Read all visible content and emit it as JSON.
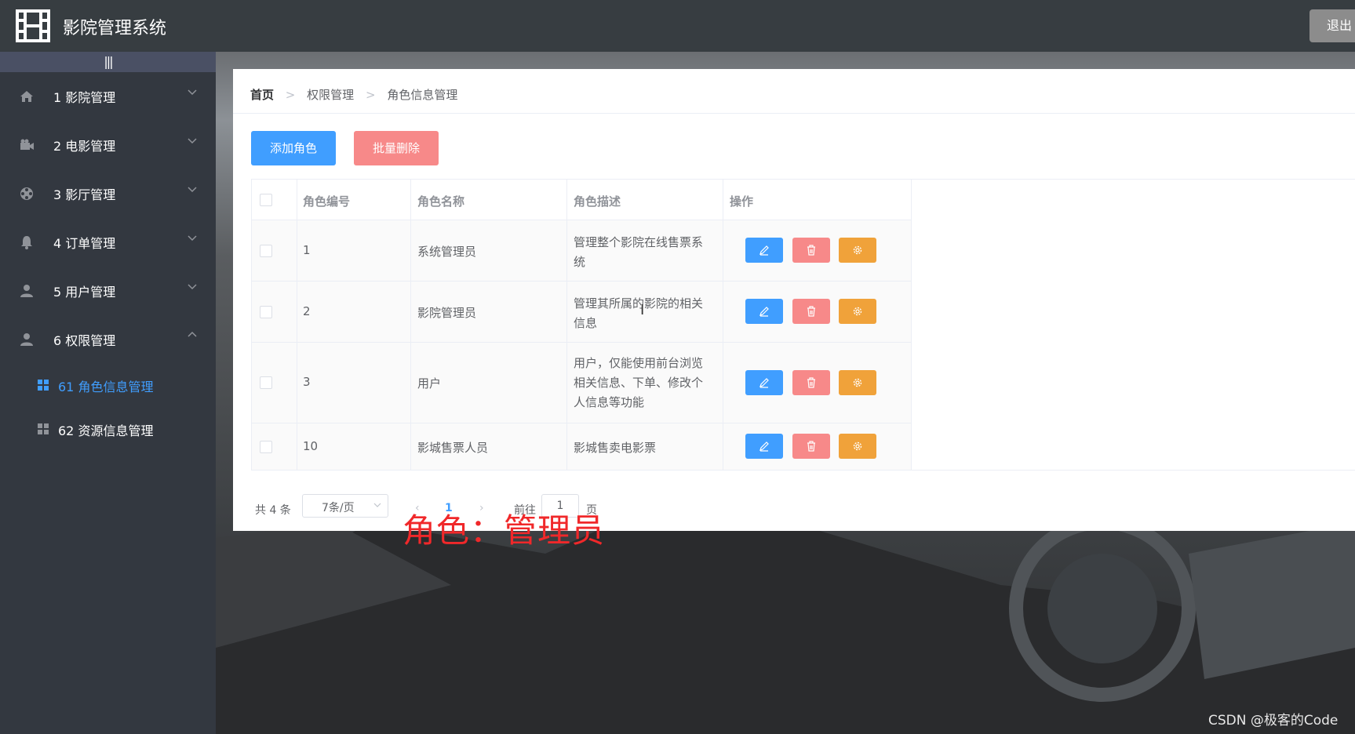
{
  "app": {
    "title": "影院管理系统",
    "logout_label": "退出"
  },
  "sidebar": {
    "collapse_glyph": "|||",
    "items": [
      {
        "label": "1 影院管理",
        "icon": "home-icon",
        "expanded": false
      },
      {
        "label": "2 电影管理",
        "icon": "camera-icon",
        "expanded": false
      },
      {
        "label": "3 影厅管理",
        "icon": "film-reel-icon",
        "expanded": false
      },
      {
        "label": "4 订单管理",
        "icon": "bell-icon",
        "expanded": false
      },
      {
        "label": "5 用户管理",
        "icon": "user-icon",
        "expanded": false
      },
      {
        "label": "6 权限管理",
        "icon": "user-icon",
        "expanded": true
      }
    ],
    "subitems": [
      {
        "label": "61 角色信息管理",
        "icon": "grid-icon",
        "active": true
      },
      {
        "label": "62 资源信息管理",
        "icon": "grid-icon",
        "active": false
      }
    ]
  },
  "breadcrumb": [
    "首页",
    "权限管理",
    "角色信息管理"
  ],
  "toolbar": {
    "add_label": "添加角色",
    "batch_delete_label": "批量删除"
  },
  "table": {
    "headers": [
      "角色编号",
      "角色名称",
      "角色描述",
      "操作"
    ],
    "rows": [
      {
        "id": "1",
        "name": "系统管理员",
        "desc_line1": "管理整个影院在线售票系",
        "desc_line2": "统",
        "desc_line3": ""
      },
      {
        "id": "2",
        "name": "影院管理员",
        "desc_line1": "管理其所属的影院的相关",
        "desc_line2": "信息",
        "desc_line3": ""
      },
      {
        "id": "3",
        "name": "用户",
        "desc_line1": "用户，仅能使用前台浏览",
        "desc_line2": "相关信息、下单、修改个",
        "desc_line3": "人信息等功能"
      },
      {
        "id": "10",
        "name": "影城售票人员",
        "desc_line1": "影城售卖电影票",
        "desc_line2": "",
        "desc_line3": ""
      }
    ]
  },
  "pagination": {
    "total": "共 4 条",
    "page_size": "7条/页",
    "current_page": "1",
    "goto_label": "前往",
    "goto_value": "1",
    "goto_unit": "页"
  },
  "caption": "角色：管理员",
  "watermark": "CSDN @极客的Code",
  "colors": {
    "primary": "#409eff",
    "danger": "#f78989",
    "warning": "#f0a23a",
    "caption": "#f0282a"
  }
}
